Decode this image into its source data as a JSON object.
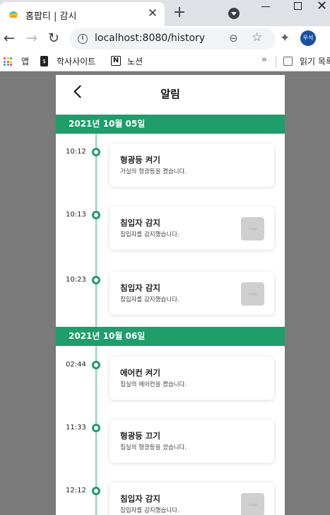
{
  "browser": {
    "tab_title": "홈팝티 | 감시",
    "url": "localhost:8080/history",
    "profile_label": "우석",
    "bookmarks": [
      {
        "label": "앱",
        "icon": "apps-grid-icon"
      },
      {
        "label": "학사사이트",
        "icon": "page-icon"
      },
      {
        "label": "노션",
        "icon": "notion-icon"
      }
    ],
    "overflow_label": "»",
    "reading_list_label": "읽기 목록"
  },
  "app": {
    "title": "알림",
    "accent_color": "#1f9d6a",
    "groups": [
      {
        "date": "2021년 10월 05일",
        "items": [
          {
            "time": "10:12",
            "title": "형광등 켜기",
            "desc": "거실의 형광등을 켰습니다.",
            "has_image": false
          },
          {
            "time": "10:13",
            "title": "침입자 감지",
            "desc": "침입자를 감지했습니다.",
            "has_image": true
          },
          {
            "time": "10:23",
            "title": "침입자 감지",
            "desc": "침입자를 감지했습니다.",
            "has_image": true
          }
        ]
      },
      {
        "date": "2021년 10월 06일",
        "items": [
          {
            "time": "02:44",
            "title": "에어컨 켜기",
            "desc": "침실의 에어컨을 켰습니다.",
            "has_image": false
          },
          {
            "time": "11:33",
            "title": "형광등 끄기",
            "desc": "침실의 형광등을 껐습니다.",
            "has_image": false
          },
          {
            "time": "12:12",
            "title": "침입자 감지",
            "desc": "침입자를 감지했습니다.",
            "has_image": true
          }
        ]
      }
    ]
  }
}
